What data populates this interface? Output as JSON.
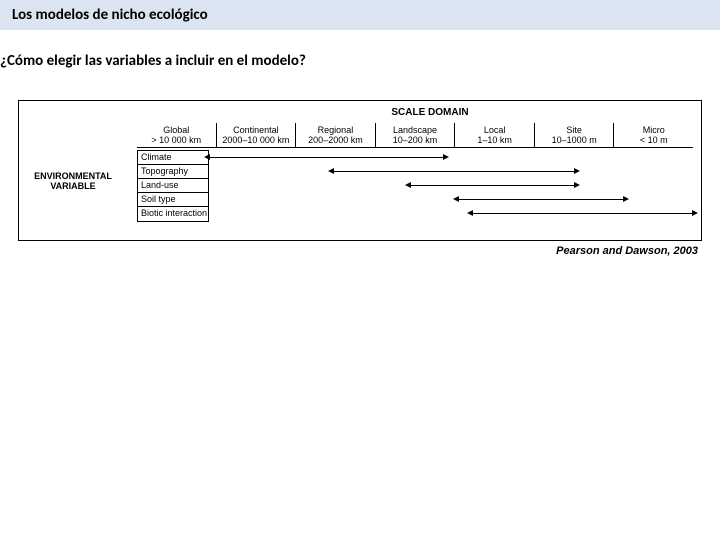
{
  "header": {
    "title": "Los modelos de nicho ecológico"
  },
  "question": {
    "text": "¿Cómo elegir las variables a incluir en el modelo?"
  },
  "diagram": {
    "scale_domain_label": "SCALE DOMAIN",
    "env_var_label": "ENVIRONMENTAL VARIABLE",
    "columns": [
      {
        "name": "Global",
        "range": "> 10 000 km"
      },
      {
        "name": "Continental",
        "range": "2000–10 000 km"
      },
      {
        "name": "Regional",
        "range": "200–2000 km"
      },
      {
        "name": "Landscape",
        "range": "10–200 km"
      },
      {
        "name": "Local",
        "range": "1–10 km"
      },
      {
        "name": "Site",
        "range": "10–1000 m"
      },
      {
        "name": "Micro",
        "range": "< 10 m"
      }
    ],
    "variables": [
      {
        "label": "Climate",
        "from": 0,
        "to": 3.4
      },
      {
        "label": "Topography",
        "from": 1.8,
        "to": 5.3
      },
      {
        "label": "Land-use",
        "from": 2.9,
        "to": 5.3
      },
      {
        "label": "Soil type",
        "from": 3.6,
        "to": 6.0
      },
      {
        "label": "Biotic interaction",
        "from": 3.8,
        "to": 7.0
      }
    ]
  },
  "citation": "Pearson and Dawson, 2003"
}
